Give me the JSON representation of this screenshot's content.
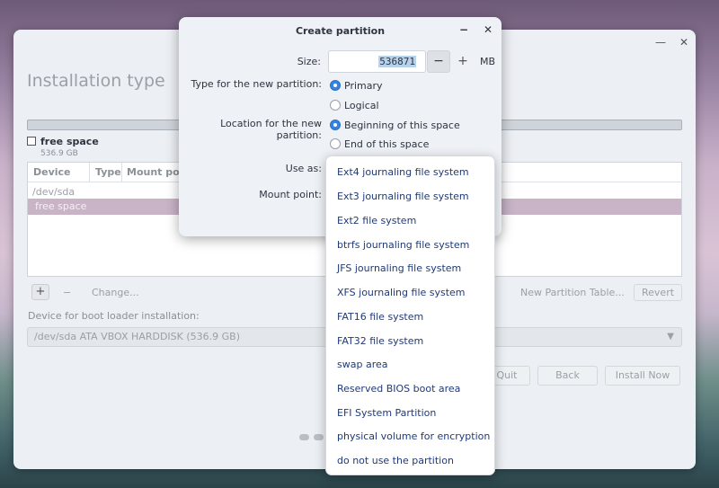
{
  "main": {
    "title": "Installation type",
    "window_buttons": [
      "—",
      "✕"
    ],
    "free_space": {
      "label": "free space",
      "size": "536.9 GB"
    },
    "table": {
      "headers": [
        "Device",
        "Type",
        "Mount poin"
      ],
      "rows": [
        "/dev/sda",
        "free space"
      ]
    },
    "toolbar": {
      "add": "+",
      "remove": "−",
      "change": "Change...",
      "new_table": "New Partition Table...",
      "revert": "Revert"
    },
    "bootloader": {
      "label": "Device for boot loader installation:",
      "value": "/dev/sda   ATA VBOX HARDDISK (536.9 GB)"
    },
    "nav": {
      "quit": "Quit",
      "back": "Back",
      "install": "Install Now"
    }
  },
  "dialog": {
    "title": "Create partition",
    "buttons": [
      "−",
      "✕"
    ],
    "size_label": "Size:",
    "size_value": "536871",
    "unit": "MB",
    "type_label": "Type for the new partition:",
    "type_options": [
      "Primary",
      "Logical"
    ],
    "type_selected": "Primary",
    "location_label": "Location for the new partition:",
    "location_options": [
      "Beginning of this space",
      "End of this space"
    ],
    "location_selected": "Beginning of this space",
    "use_as_label": "Use as:",
    "mount_label": "Mount point:"
  },
  "use_as_menu": [
    "Ext4 journaling file system",
    "Ext3 journaling file system",
    "Ext2 file system",
    "btrfs journaling file system",
    "JFS journaling file system",
    "XFS journaling file system",
    "FAT16 file system",
    "FAT32 file system",
    "swap area",
    "Reserved BIOS boot area",
    "EFI System Partition",
    "physical volume for encryption",
    "do not use the partition"
  ]
}
